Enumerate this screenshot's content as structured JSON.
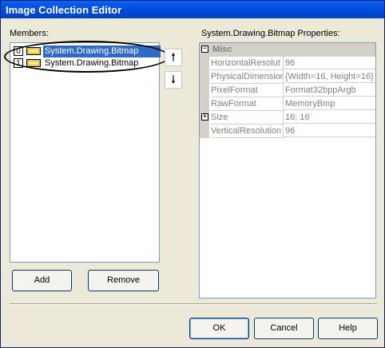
{
  "window": {
    "title": "Image Collection Editor"
  },
  "members": {
    "label": "Members:",
    "items": [
      {
        "index": "0",
        "label": "System.Drawing.Bitmap",
        "selected": true
      },
      {
        "index": "1",
        "label": "System.Drawing.Bitmap",
        "selected": false
      }
    ],
    "move_up_icon": "arrow-up-icon",
    "move_down_icon": "arrow-down-icon",
    "add_label": "Add",
    "remove_label": "Remove"
  },
  "properties": {
    "label": "System.Drawing.Bitmap Properties:",
    "category": "Misc",
    "rows": [
      {
        "name": "HorizontalResolut",
        "value": "96"
      },
      {
        "name": "PhysicalDimension",
        "value": "{Width=16, Height=16}"
      },
      {
        "name": "PixelFormat",
        "value": "Format32bppArgb"
      },
      {
        "name": "RawFormat",
        "value": "MemoryBmp"
      },
      {
        "name": "Size",
        "value": "16; 16",
        "expandable": true
      },
      {
        "name": "VerticalResolution",
        "value": "96"
      }
    ]
  },
  "footer": {
    "ok_label": "OK",
    "cancel_label": "Cancel",
    "help_label": "Help"
  },
  "colors": {
    "selection": "#316ac5",
    "titlebar": "#0a58e8"
  }
}
